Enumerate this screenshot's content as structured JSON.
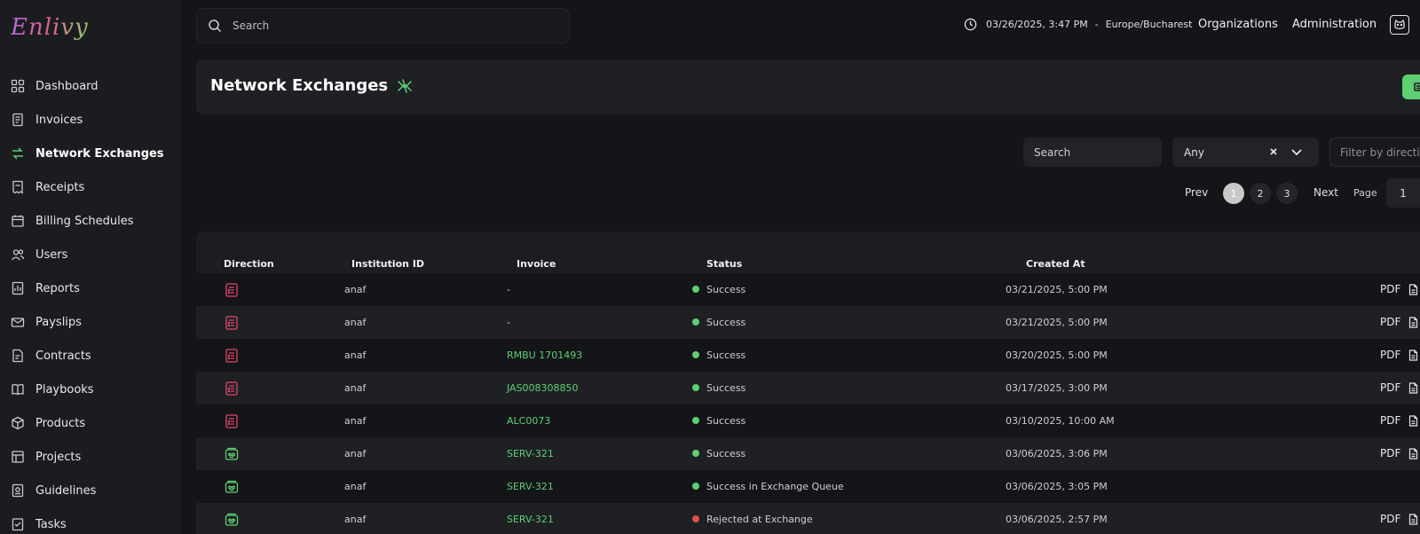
{
  "app": {
    "logo": "Enlivy"
  },
  "sidebar": {
    "items": [
      {
        "label": "Dashboard",
        "icon": "grid-icon",
        "active": false
      },
      {
        "label": "Invoices",
        "icon": "invoice-icon",
        "active": false
      },
      {
        "label": "Network Exchanges",
        "icon": "exchange-icon",
        "active": true
      },
      {
        "label": "Receipts",
        "icon": "receipt-icon",
        "active": false
      },
      {
        "label": "Billing Schedules",
        "icon": "billing-schedule-icon",
        "active": false
      },
      {
        "label": "Users",
        "icon": "users-icon",
        "active": false
      },
      {
        "label": "Reports",
        "icon": "report-icon",
        "active": false
      },
      {
        "label": "Payslips",
        "icon": "payslip-icon",
        "active": false
      },
      {
        "label": "Contracts",
        "icon": "contract-icon",
        "active": false
      },
      {
        "label": "Playbooks",
        "icon": "playbook-icon",
        "active": false
      },
      {
        "label": "Products",
        "icon": "product-box-icon",
        "active": false
      },
      {
        "label": "Projects",
        "icon": "project-icon",
        "active": false
      },
      {
        "label": "Guidelines",
        "icon": "guideline-icon",
        "active": false
      },
      {
        "label": "Tasks",
        "icon": "task-icon",
        "active": false
      }
    ]
  },
  "topbar": {
    "search_placeholder": "Search",
    "datetime": "03/26/2025, 3:47 PM",
    "separator": "-",
    "timezone": "Europe/Bucharest",
    "organizations": "Organizations",
    "administration": "Administration"
  },
  "page": {
    "title": "Network Exchanges"
  },
  "filters": {
    "search_placeholder": "Search",
    "status_value": "Any",
    "direction_placeholder": "Filter by direction"
  },
  "pagination": {
    "prev": "Prev",
    "next": "Next",
    "pages": [
      "1",
      "2",
      "3"
    ],
    "current": "1",
    "page_label": "Page",
    "page_value": "1"
  },
  "table": {
    "columns": [
      "Direction",
      "Institution ID",
      "Invoice",
      "Status",
      "Created At"
    ],
    "pdf_label": "PDF",
    "status_colors": {
      "success": "#5ecf73",
      "rejected": "#e0524a"
    },
    "direction_colors": {
      "outgoing": "#e0466b",
      "incoming": "#5ecf73"
    },
    "rows": [
      {
        "direction": "outgoing",
        "institution": "anaf",
        "invoice": "-",
        "invoice_link": false,
        "status": "Success",
        "status_kind": "success",
        "created": "03/21/2025, 5:00 PM",
        "pdf": true
      },
      {
        "direction": "outgoing",
        "institution": "anaf",
        "invoice": "-",
        "invoice_link": false,
        "status": "Success",
        "status_kind": "success",
        "created": "03/21/2025, 5:00 PM",
        "pdf": true
      },
      {
        "direction": "outgoing",
        "institution": "anaf",
        "invoice": "RMBU 1701493",
        "invoice_link": true,
        "status": "Success",
        "status_kind": "success",
        "created": "03/20/2025, 5:00 PM",
        "pdf": true
      },
      {
        "direction": "outgoing",
        "institution": "anaf",
        "invoice": "JAS008308850",
        "invoice_link": true,
        "status": "Success",
        "status_kind": "success",
        "created": "03/17/2025, 3:00 PM",
        "pdf": true
      },
      {
        "direction": "outgoing",
        "institution": "anaf",
        "invoice": "ALC0073",
        "invoice_link": true,
        "status": "Success",
        "status_kind": "success",
        "created": "03/10/2025, 10:00 AM",
        "pdf": true
      },
      {
        "direction": "incoming",
        "institution": "anaf",
        "invoice": "SERV-321",
        "invoice_link": true,
        "status": "Success",
        "status_kind": "success",
        "created": "03/06/2025, 3:06 PM",
        "pdf": true
      },
      {
        "direction": "incoming",
        "institution": "anaf",
        "invoice": "SERV-321",
        "invoice_link": true,
        "status": "Success in Exchange Queue",
        "status_kind": "success",
        "created": "03/06/2025, 3:05 PM",
        "pdf": false
      },
      {
        "direction": "incoming",
        "institution": "anaf",
        "invoice": "SERV-321",
        "invoice_link": true,
        "status": "Rejected at Exchange",
        "status_kind": "rejected",
        "created": "03/06/2025, 2:57 PM",
        "pdf": true
      }
    ]
  }
}
